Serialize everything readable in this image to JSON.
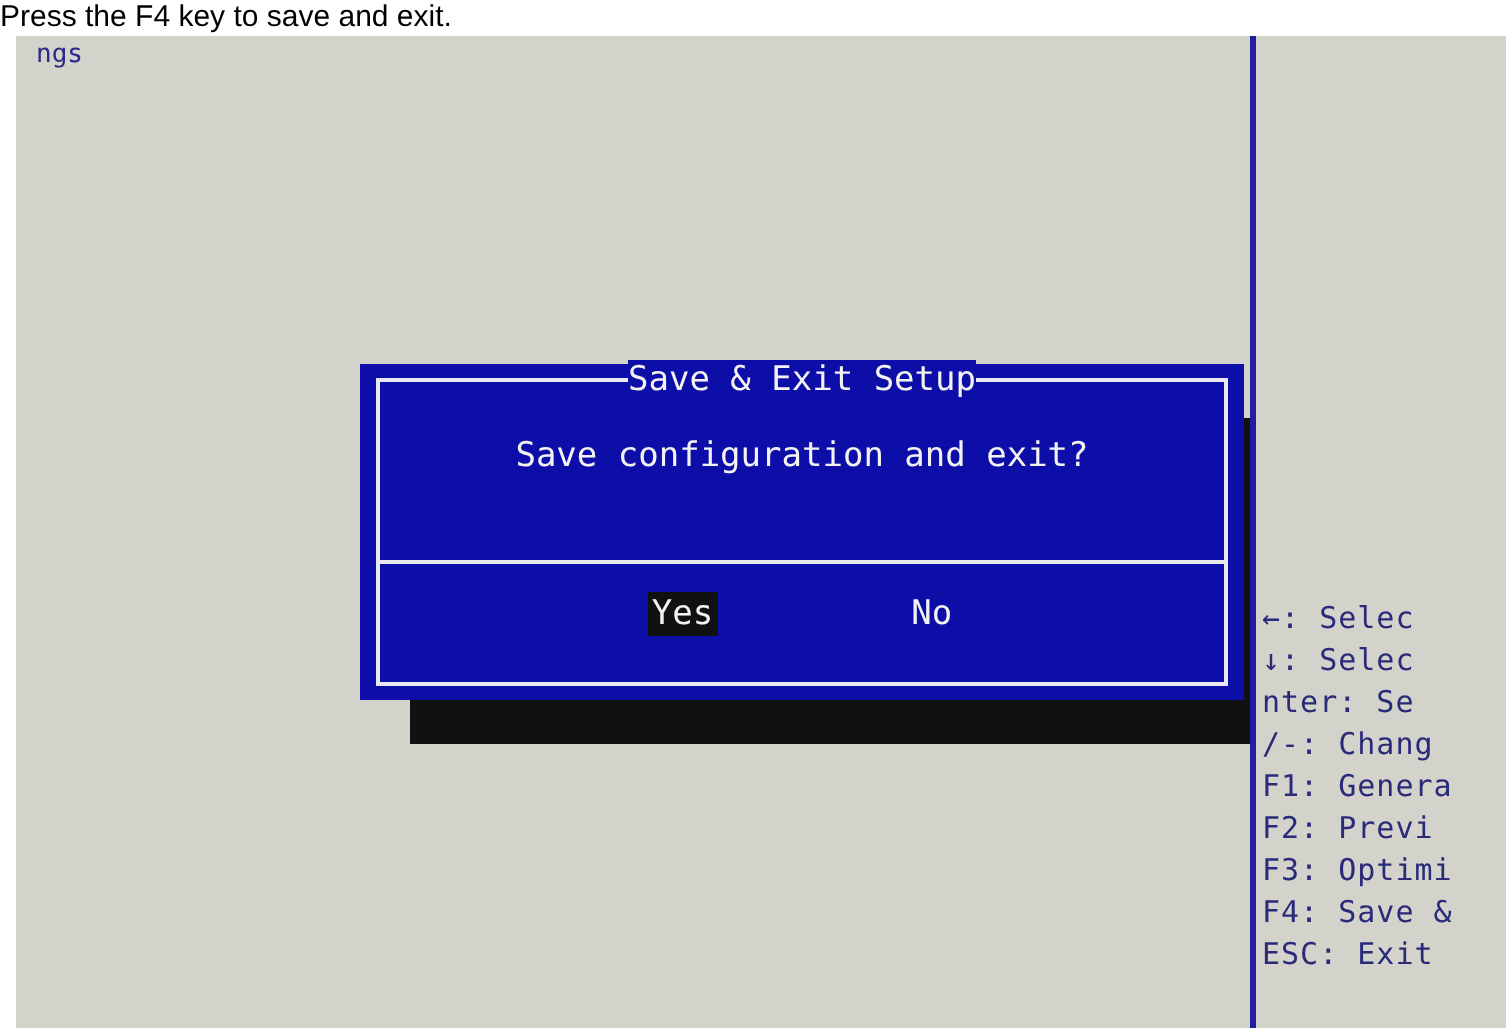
{
  "caption": "Press the F4 key to save and exit.",
  "screen": {
    "section_title": "ngs",
    "help_lines": [
      "←: Selec",
      "↓: Selec",
      "nter: Se",
      "/-: Chang",
      "F1: Genera",
      "F2: Previ",
      "F3: Optimi",
      "F4: Save &",
      "ESC: Exit"
    ]
  },
  "dialog": {
    "title": "Save & Exit Setup",
    "message": "Save configuration and exit?",
    "buttons": [
      {
        "label": "Yes",
        "selected": true
      },
      {
        "label": "No",
        "selected": false
      }
    ]
  }
}
